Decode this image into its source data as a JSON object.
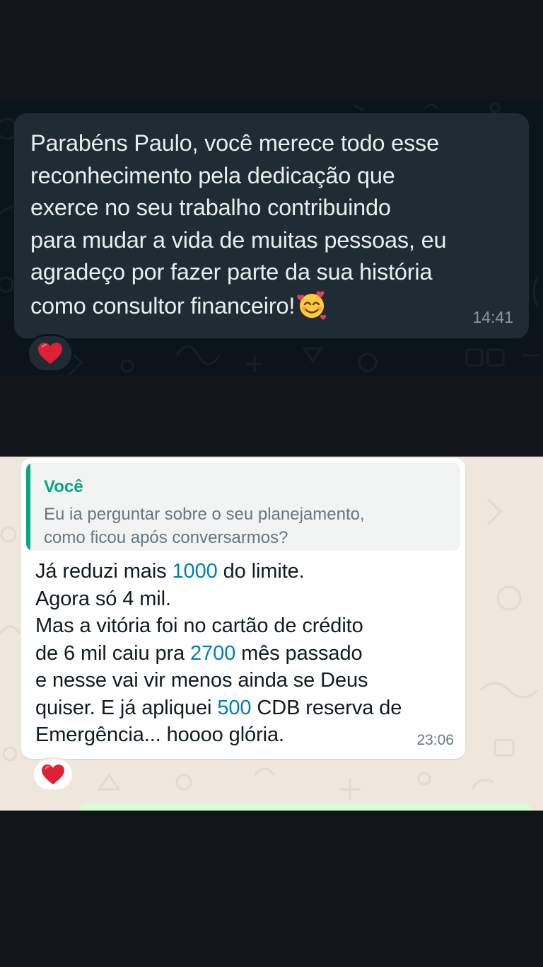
{
  "conversation_1": {
    "theme": "dark",
    "message": {
      "text": "Parabéns Paulo, você merece todo esse\nreconhecimento pela dedicação que\nexerce no seu trabalho contribuindo\npara mudar a vida de muitas pessoas, eu\nagradeço por fazer parte da sua história\ncomo consultor financeiro!",
      "trailing_emoji": "smiling-face-with-hearts-icon",
      "time": "14:41",
      "reaction": "red-heart-icon"
    },
    "colors": {
      "background": "#0b141a",
      "bubble": "#202c33",
      "text": "#e9edef",
      "timestamp": "#8696a0"
    }
  },
  "conversation_2": {
    "theme": "light",
    "message": {
      "quoted": {
        "author": "Você",
        "text": "Eu ia perguntar sobre o seu planejamento,\ncomo ficou após conversarmos?"
      },
      "lines": [
        {
          "before": "Já reduzi mais ",
          "number": "1000",
          "after": " do limite."
        },
        {
          "before": "Agora só 4 mil.",
          "number": "",
          "after": ""
        },
        {
          "before": "Mas a vitória foi no cartão de crédito",
          "number": "",
          "after": ""
        },
        {
          "before": "de 6 mil caiu pra ",
          "number": "2700",
          "after": " mês passado"
        },
        {
          "before": "e nesse vai vir menos ainda se Deus",
          "number": "",
          "after": ""
        },
        {
          "before": "quiser. E já apliquei ",
          "number": "500",
          "after": " CDB reserva de"
        },
        {
          "before": "Emergência... hoooo glória.",
          "number": "",
          "after": ""
        }
      ],
      "time": "23:06",
      "reaction": "red-heart-icon"
    },
    "colors": {
      "background": "#efe7dd",
      "bubble": "#ffffff",
      "quote_accent": "#06a884",
      "number_link": "#027eb5",
      "text": "#111b21",
      "timestamp": "#667781"
    }
  }
}
